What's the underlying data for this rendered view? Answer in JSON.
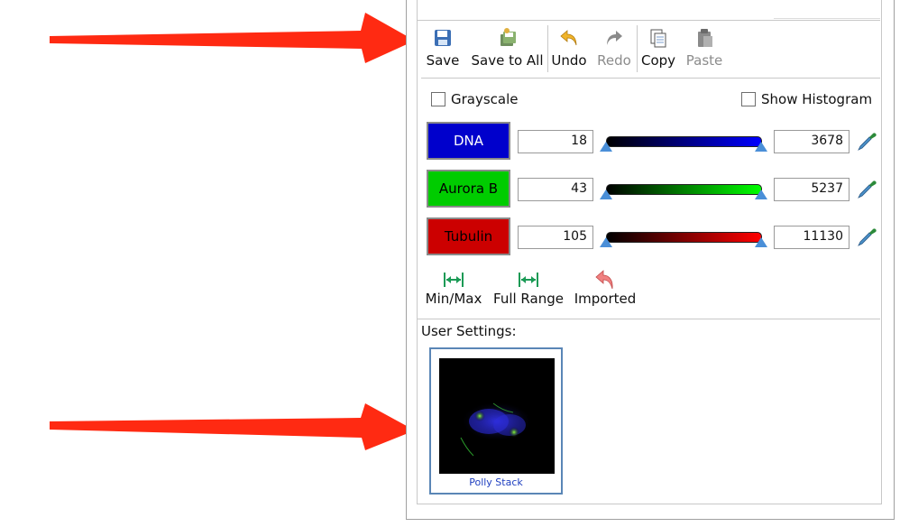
{
  "toolbar": {
    "save": "Save",
    "save_all": "Save to All",
    "undo": "Undo",
    "redo": "Redo",
    "copy": "Copy",
    "paste": "Paste"
  },
  "options": {
    "grayscale": "Grayscale",
    "show_histogram": "Show Histogram"
  },
  "channels": [
    {
      "name": "DNA",
      "min": "18",
      "max": "3678",
      "color": "#0000cc",
      "text_color": "#ffffff"
    },
    {
      "name": "Aurora B",
      "min": "43",
      "max": "5237",
      "color": "#00cc00",
      "text_color": "#000000"
    },
    {
      "name": "Tubulin",
      "min": "105",
      "max": "11130",
      "color": "#cc0000",
      "text_color": "#000000"
    }
  ],
  "range_buttons": {
    "min_max": "Min/Max",
    "full_range": "Full Range",
    "imported": "Imported"
  },
  "user_settings": {
    "label": "User Settings:",
    "thumbnail_caption": "Polly Stack"
  },
  "colors": {
    "annotation_arrow": "#ff2a12",
    "slider_thumb": "#4a8fd8"
  }
}
